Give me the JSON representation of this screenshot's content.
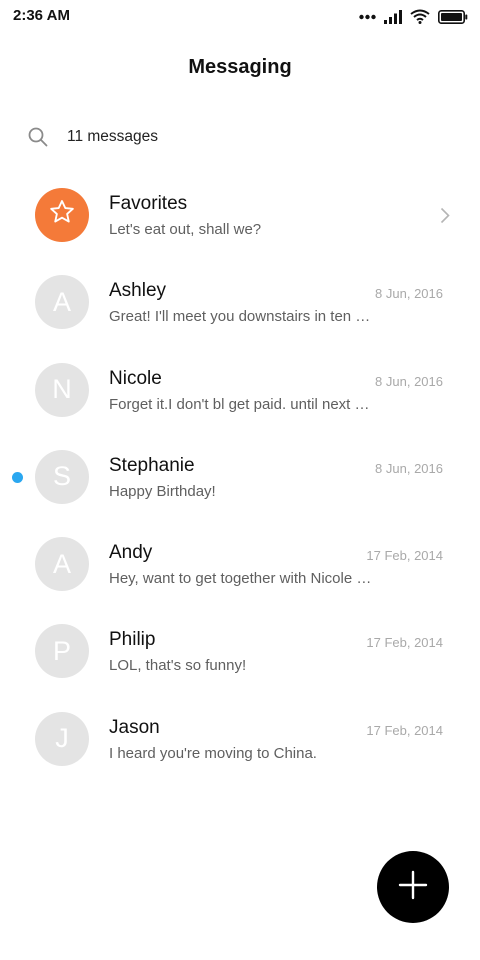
{
  "status_bar": {
    "time": "2:36 AM",
    "icons": [
      "signal-dots-icon",
      "signal-bars-icon",
      "wifi-icon",
      "battery-icon"
    ]
  },
  "header": {
    "title": "Messaging"
  },
  "search": {
    "icon": "search-icon",
    "text": "11 messages"
  },
  "conversations": [
    {
      "name": "Favorites",
      "preview": "Let's eat out, shall we?",
      "date": "",
      "avatar_icon": "star-icon",
      "has_chevron": true
    },
    {
      "name": "Ashley",
      "preview": "Great! I'll meet you downstairs in ten …",
      "date": "8 Jun, 2016",
      "avatar_letter": "A"
    },
    {
      "name": "Nicole",
      "preview": "Forget it.I don't bl get paid. until next …",
      "date": "8 Jun, 2016",
      "avatar_letter": "N"
    },
    {
      "name": "Stephanie",
      "preview": "Happy Birthday!",
      "date": "8 Jun, 2016",
      "avatar_letter": "S",
      "unread": true
    },
    {
      "name": "Andy",
      "preview": "Hey, want to get together with Nicole …",
      "date": "17 Feb, 2014",
      "avatar_letter": "A"
    },
    {
      "name": "Philip",
      "preview": "LOL, that's so funny!",
      "date": "17 Feb, 2014",
      "avatar_letter": "P"
    },
    {
      "name": "Jason",
      "preview": "I heard you're moving to China.",
      "date": "17 Feb, 2014",
      "avatar_letter": "J"
    }
  ],
  "fab": {
    "icon": "plus-icon"
  },
  "colors": {
    "favorites_avatar": "#f47a39",
    "avatar_placeholder": "#e4e4e4",
    "unread_dot": "#2aa7f0",
    "fab": "#000000"
  }
}
